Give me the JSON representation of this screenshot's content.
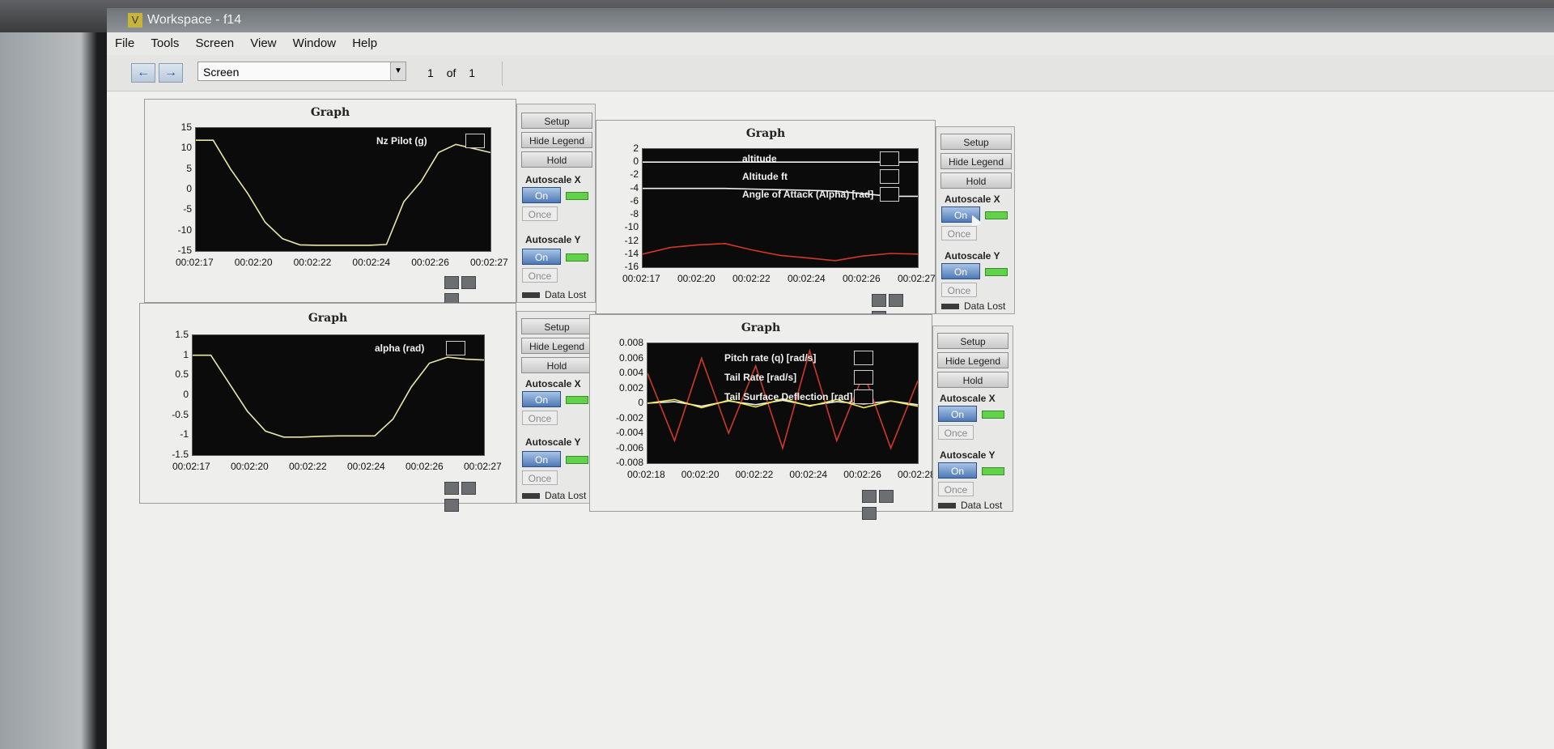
{
  "window": {
    "title": "Workspace - f14"
  },
  "menu": [
    "File",
    "Tools",
    "Screen",
    "View",
    "Window",
    "Help"
  ],
  "toolbar": {
    "back_icon": "left-arrow-icon",
    "forward_icon": "right-arrow-icon",
    "screen_select": "Screen",
    "page_current": "1",
    "page_of": "of",
    "page_total": "1"
  },
  "controls_text": {
    "setup": "Setup",
    "hide_legend": "Hide Legend",
    "hold": "Hold",
    "autoscale_x": "Autoscale X",
    "autoscale_y": "Autoscale Y",
    "on": "On",
    "once": "Once",
    "data_lost": "Data Lost"
  },
  "colors": {
    "plot_bg": "#0b0b0b",
    "trace_yellow": "#e9e7a8",
    "trace_white": "#f0f0f0",
    "trace_red": "#d03828",
    "trace_bright_yellow": "#f2e85a",
    "led_green": "#5fd24a",
    "on_button_blue": "#4f79b6"
  },
  "graphs": [
    {
      "title": "Graph",
      "yticks": [
        "15",
        "10",
        "5",
        "0",
        "-5",
        "-10",
        "-15"
      ],
      "xticks": [
        "00:02:17",
        "00:02:20",
        "00:02:22",
        "00:02:24",
        "00:02:26",
        "00:02:27"
      ],
      "legend": [
        "Nz Pilot (g)"
      ]
    },
    {
      "title": "Graph",
      "yticks": [
        "2",
        "0",
        "-2",
        "-4",
        "-6",
        "-8",
        "-10",
        "-12",
        "-14",
        "-16"
      ],
      "xticks": [
        "00:02:17",
        "00:02:20",
        "00:02:22",
        "00:02:24",
        "00:02:26",
        "00:02:27"
      ],
      "legend": [
        "altitude",
        "Altitude ft",
        "Angle of Attack (Alpha) [rad]"
      ]
    },
    {
      "title": "Graph",
      "yticks": [
        "1.5",
        "1",
        "0.5",
        "0",
        "-0.5",
        "-1",
        "-1.5"
      ],
      "xticks": [
        "00:02:17",
        "00:02:20",
        "00:02:22",
        "00:02:24",
        "00:02:26",
        "00:02:27"
      ],
      "legend": [
        "alpha (rad)"
      ]
    },
    {
      "title": "Graph",
      "yticks": [
        "0.008",
        "0.006",
        "0.004",
        "0.002",
        "0",
        "-0.002",
        "-0.004",
        "-0.006",
        "-0.008"
      ],
      "xticks": [
        "00:02:18",
        "00:02:20",
        "00:02:22",
        "00:02:24",
        "00:02:26",
        "00:02:28"
      ],
      "legend": [
        "Pitch rate (q) [rad/s]",
        "Tail Rate [rad/s]",
        "Tail Surface Deflection [rad]"
      ]
    }
  ],
  "chart_data": [
    {
      "type": "line",
      "title": "Graph",
      "ylim": [
        -15,
        15
      ],
      "x": [
        "00:02:17",
        "00:02:17.5",
        "00:02:18",
        "00:02:18.5",
        "00:02:19",
        "00:02:19.5",
        "00:02:20",
        "00:02:21",
        "00:02:22",
        "00:02:23",
        "00:02:24",
        "00:02:24.2",
        "00:02:24.5",
        "00:02:25",
        "00:02:25.5",
        "00:02:26",
        "00:02:26.5",
        "00:02:27"
      ],
      "series": [
        {
          "name": "Nz Pilot (g)",
          "values": [
            12,
            12,
            5,
            -1,
            -8,
            -12,
            -13.5,
            -13.6,
            -13.6,
            -13.6,
            -13.6,
            -13.4,
            -3,
            2,
            9,
            11,
            10,
            9
          ]
        }
      ]
    },
    {
      "type": "line",
      "title": "Graph",
      "ylim": [
        -16,
        2
      ],
      "x": [
        "00:02:17",
        "00:02:18",
        "00:02:19",
        "00:02:20",
        "00:02:21",
        "00:02:22",
        "00:02:23",
        "00:02:24",
        "00:02:25",
        "00:02:26",
        "00:02:27"
      ],
      "series": [
        {
          "name": "altitude",
          "values": [
            0,
            0,
            0,
            0,
            0,
            0,
            0,
            0,
            0,
            0,
            0
          ]
        },
        {
          "name": "Altitude ft",
          "values": [
            -14,
            -13,
            -12.6,
            -12.4,
            -13.4,
            -14.2,
            -14.6,
            -15,
            -14.3,
            -13.9,
            -14
          ]
        },
        {
          "name": "Angle of Attack (Alpha) [rad]",
          "values": [
            -4,
            -4,
            -4,
            -4,
            -4.1,
            -4.2,
            -4.3,
            -4.4,
            -4.8,
            -5.2,
            -5.2
          ]
        }
      ]
    },
    {
      "type": "line",
      "title": "Graph",
      "ylim": [
        -1.5,
        1.5
      ],
      "x": [
        "00:02:17",
        "00:02:17.5",
        "00:02:18",
        "00:02:18.5",
        "00:02:19",
        "00:02:19.5",
        "00:02:20",
        "00:02:21",
        "00:02:22",
        "00:02:23",
        "00:02:24",
        "00:02:24.5",
        "00:02:25",
        "00:02:25.5",
        "00:02:26",
        "00:02:26.5",
        "00:02:27"
      ],
      "series": [
        {
          "name": "alpha (rad)",
          "values": [
            1,
            1,
            0.3,
            -0.4,
            -0.9,
            -1.05,
            -1.05,
            -1.03,
            -1.02,
            -1.02,
            -1.02,
            -0.6,
            0.2,
            0.8,
            0.95,
            0.9,
            0.88
          ]
        }
      ]
    },
    {
      "type": "line",
      "title": "Graph",
      "ylim": [
        -0.008,
        0.008
      ],
      "x": [
        "00:02:18",
        "00:02:19",
        "00:02:20",
        "00:02:21",
        "00:02:22",
        "00:02:23",
        "00:02:24",
        "00:02:25",
        "00:02:26",
        "00:02:27",
        "00:02:28"
      ],
      "series": [
        {
          "name": "Pitch rate (q) [rad/s]",
          "values": [
            0,
            0.0002,
            -0.0004,
            0.0003,
            -0.0002,
            0.0004,
            -0.0003,
            0.0002,
            -0.0001,
            0.0003,
            -0.0002
          ]
        },
        {
          "name": "Tail Rate [rad/s]",
          "values": [
            0.004,
            -0.005,
            0.006,
            -0.004,
            0.005,
            -0.006,
            0.007,
            -0.005,
            0.004,
            -0.006,
            0.003
          ]
        },
        {
          "name": "Tail Surface Deflection [rad]",
          "values": [
            0,
            0.0005,
            -0.0006,
            0.0004,
            -0.0005,
            0.0006,
            -0.0004,
            0.0005,
            -0.0006,
            0.0003,
            -0.0004
          ]
        }
      ]
    }
  ]
}
